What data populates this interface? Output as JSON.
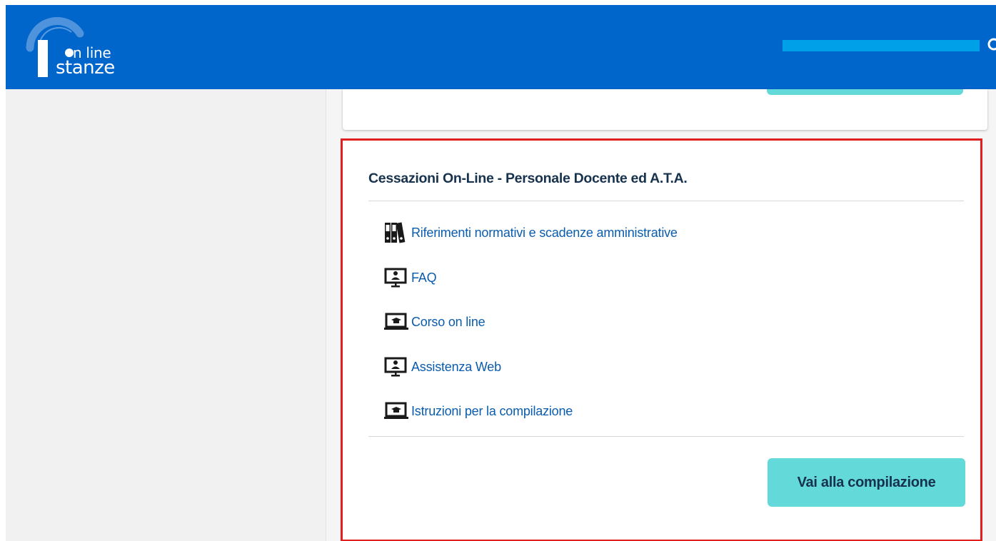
{
  "header": {
    "logo_line1": "n line",
    "logo_line2": "stanze",
    "brand_color": "#0066cc"
  },
  "card": {
    "title": "Cessazioni On-Line - Personale Docente ed A.T.A.",
    "links": [
      {
        "label": "Riferimenti normativi e scadenze amministrative",
        "icon": "binders-icon"
      },
      {
        "label": "FAQ",
        "icon": "monitor-user-icon"
      },
      {
        "label": "Corso on line",
        "icon": "laptop-graduation-icon"
      },
      {
        "label": "Assistenza Web",
        "icon": "monitor-user-icon"
      },
      {
        "label": "Istruzioni per la compilazione",
        "icon": "laptop-graduation-icon"
      }
    ],
    "cta_label": "Vai alla compilazione",
    "link_color": "#0a5cad",
    "highlight_border_color": "#e02020",
    "cta_color": "#63d9da"
  }
}
